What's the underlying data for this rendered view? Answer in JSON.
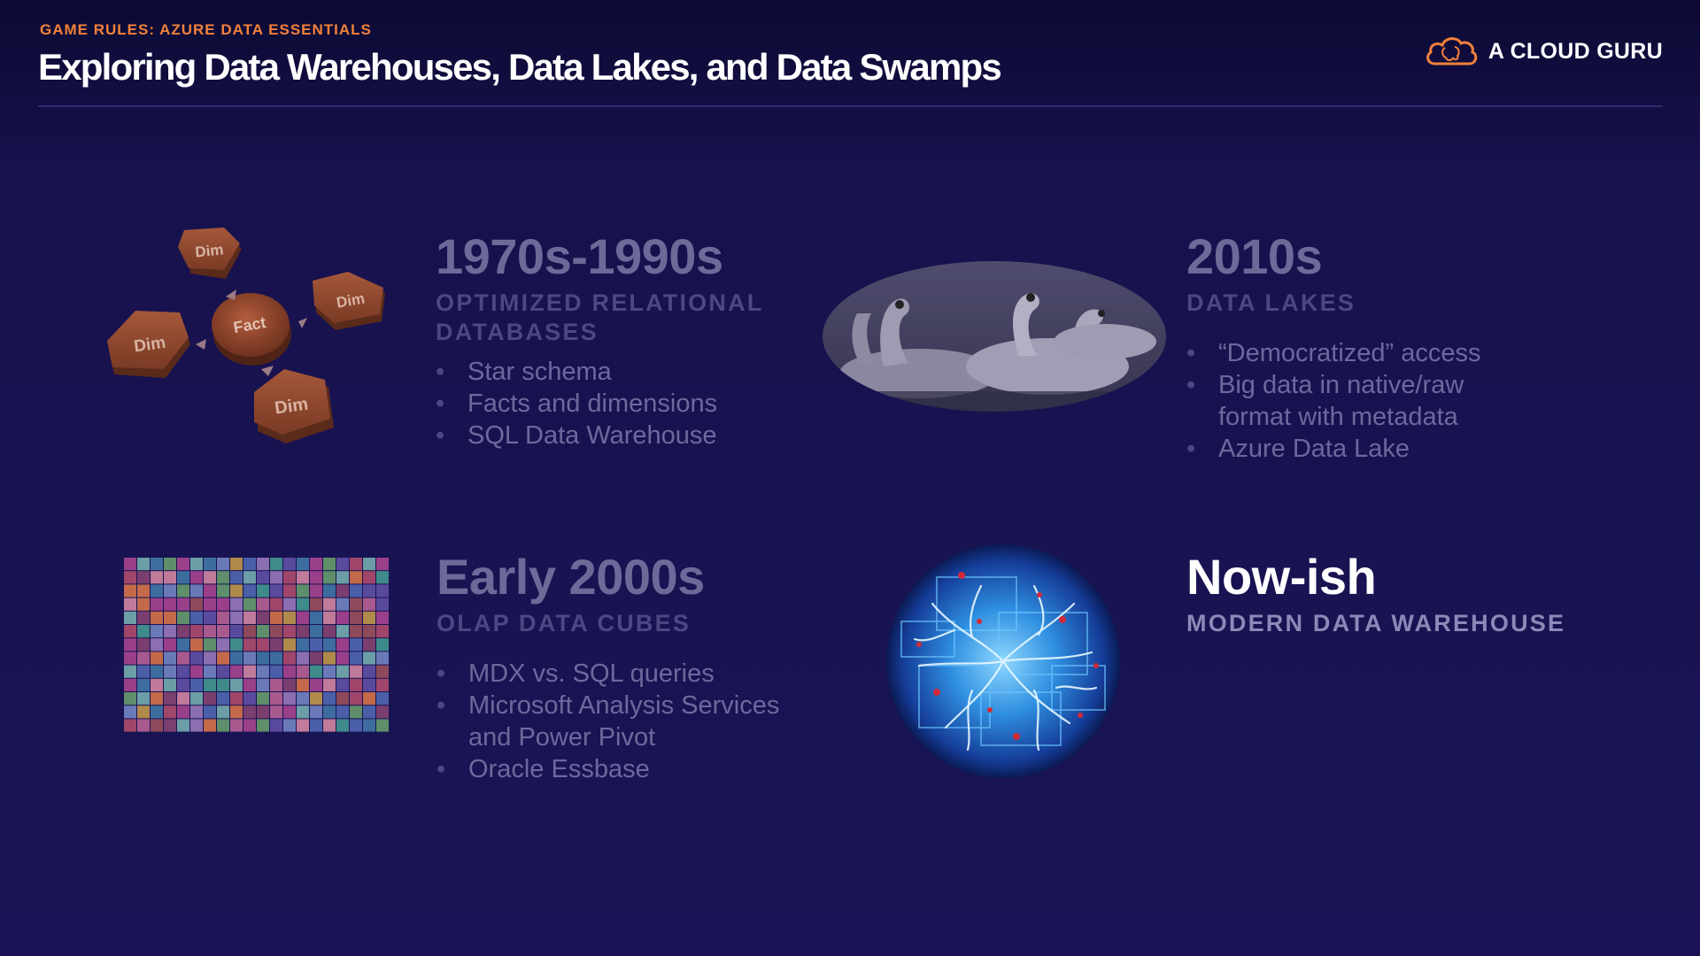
{
  "header": {
    "kicker": "GAME RULES: AZURE DATA ESSENTIALS",
    "title": "Exploring Data Warehouses, Data Lakes, and Data Swamps",
    "logo_text": "A CLOUD GURU",
    "logo_icon": "cloud-brain-icon"
  },
  "sections": [
    {
      "era": "1970s-1990s",
      "subhead": "OPTIMIZED RELATIONAL DATABASES",
      "bullets": [
        "Star schema",
        "Facts and dimensions",
        "SQL Data Warehouse"
      ],
      "image": {
        "center_label": "Fact",
        "node_label": "Dim"
      }
    },
    {
      "era": "2010s",
      "subhead": "DATA LAKES",
      "bullets": [
        "“Democratized” access",
        "Big data in native/raw format with metadata",
        "Azure Data Lake"
      ]
    },
    {
      "era": "Early 2000s",
      "subhead": "OLAP DATA CUBES",
      "bullets": [
        "MDX vs. SQL queries",
        "Microsoft Analysis Services and Power Pivot",
        "Oracle Essbase"
      ]
    },
    {
      "era": "Now-ish",
      "subhead": "MODERN DATA WAREHOUSE",
      "bullets": []
    }
  ],
  "colors": {
    "accent": "#f2813a",
    "background": "#1a1456",
    "dimmed_text": "#6d6a99",
    "active_text": "#ffffff"
  }
}
